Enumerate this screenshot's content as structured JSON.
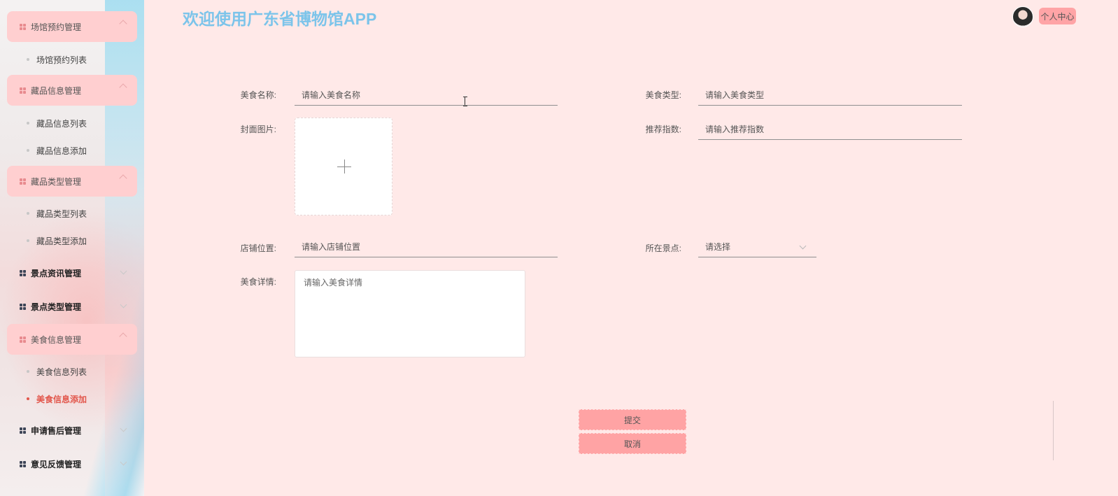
{
  "header": {
    "title": "欢迎使用广东省博物馆APP",
    "user_center": "个人中心"
  },
  "sidebar": {
    "groups": [
      {
        "label": "场馆预约管理",
        "expanded": true,
        "items": [
          "场馆预约列表"
        ]
      },
      {
        "label": "藏品信息管理",
        "expanded": true,
        "items": [
          "藏品信息列表",
          "藏品信息添加"
        ]
      },
      {
        "label": "藏品类型管理",
        "expanded": true,
        "items": [
          "藏品类型列表",
          "藏品类型添加"
        ]
      },
      {
        "label": "景点资讯管理",
        "expanded": false,
        "items": []
      },
      {
        "label": "景点类型管理",
        "expanded": false,
        "items": []
      },
      {
        "label": "美食信息管理",
        "expanded": true,
        "items": [
          "美食信息列表",
          "美食信息添加"
        ]
      },
      {
        "label": "申请售后管理",
        "expanded": false,
        "items": []
      },
      {
        "label": "意见反馈管理",
        "expanded": false,
        "items": []
      }
    ],
    "active_item": "美食信息添加"
  },
  "form": {
    "food_name": {
      "label": "美食名称:",
      "placeholder": "请输入美食名称"
    },
    "food_type": {
      "label": "美食类型:",
      "placeholder": "请输入美食类型"
    },
    "cover_image": {
      "label": "封面图片:"
    },
    "recommend_index": {
      "label": "推荐指数:",
      "placeholder": "请输入推荐指数"
    },
    "shop_location": {
      "label": "店铺位置:",
      "placeholder": "请输入店铺位置"
    },
    "scenic_spot": {
      "label": "所在景点:",
      "selected": "请选择"
    },
    "food_detail": {
      "label": "美食详情:",
      "placeholder": "请输入美食详情"
    },
    "submit_label": "提交",
    "cancel_label": "取消"
  },
  "colors": {
    "background": "#ffe9e8",
    "title": "#7cc4ea",
    "menu_group_bg": "#ffcfd0",
    "button_bg": "#ffa3a4",
    "active_item": "#e2574c"
  }
}
